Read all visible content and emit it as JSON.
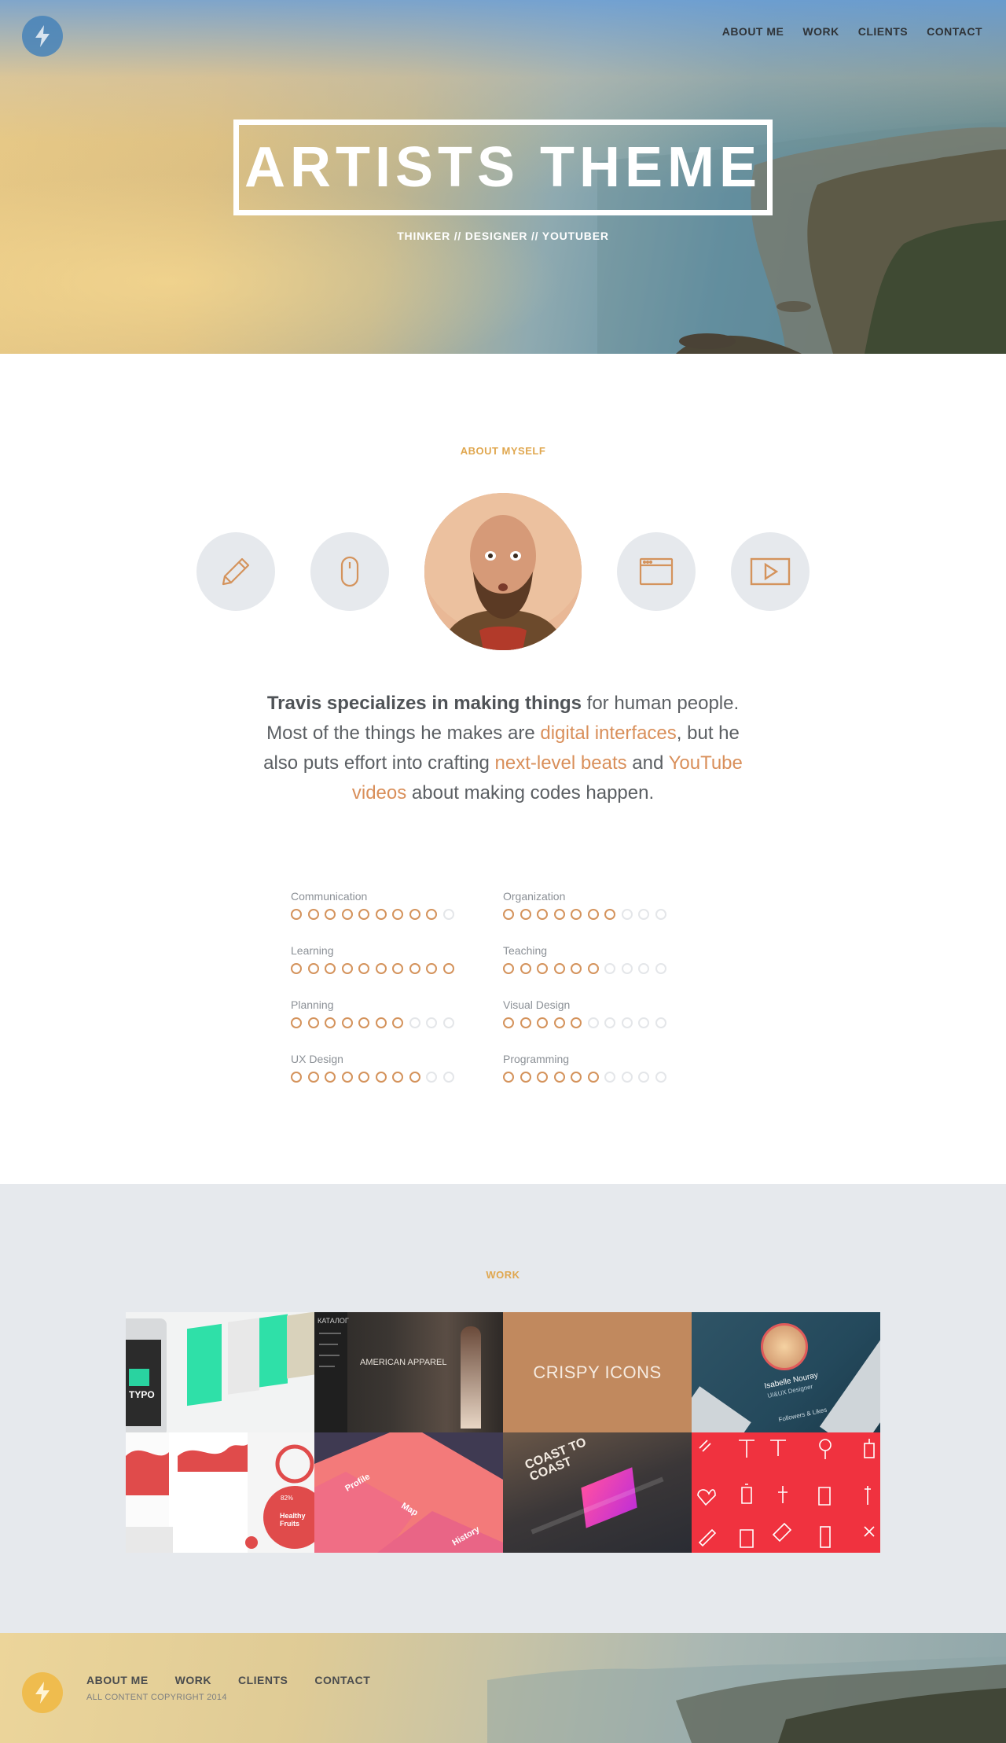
{
  "nav": {
    "items": [
      "ABOUT ME",
      "WORK",
      "CLIENTS",
      "CONTACT"
    ]
  },
  "hero": {
    "title": "ARTISTS THEME",
    "tagline": "THINKER // DESIGNER // YOUTUBER"
  },
  "about": {
    "label": "ABOUT MYSELF",
    "bio": {
      "bold": "Travis specializes in making things",
      "t1": " for human people. Most of the things he makes are ",
      "link1": "digital interfaces",
      "t2": ", but he also puts effort into crafting ",
      "link2": "next-level beats",
      "t3": " and ",
      "link3": "YouTube videos",
      "t4": " about making codes happen."
    },
    "icons": [
      "pencil-icon",
      "mouse-icon",
      "browser-window-icon",
      "play-icon"
    ]
  },
  "skills": [
    {
      "name": "Communication",
      "level": 9
    },
    {
      "name": "Organization",
      "level": 7
    },
    {
      "name": "Learning",
      "level": 10
    },
    {
      "name": "Teaching",
      "level": 6
    },
    {
      "name": "Planning",
      "level": 7
    },
    {
      "name": "Visual Design",
      "level": 5
    },
    {
      "name": "UX Design",
      "level": 8
    },
    {
      "name": "Programming",
      "level": 6
    }
  ],
  "skill_max": 10,
  "work": {
    "label": "WORK",
    "tiles": {
      "typo_brand": "TYPO",
      "catalog_menu": "КАТАЛОГ",
      "apparel_title": "AMERICAN APPAREL",
      "crispy": "CRISPY ICONS",
      "profile_name": "Isabelle Nouray",
      "profile_role": "UI&UX Designer",
      "profile_footer": "Followers & Likes",
      "fruits_pct": "82%",
      "fruits_title": "Healthy Fruits",
      "menu_profile": "Profile",
      "menu_map": "Map",
      "menu_history": "History",
      "coast_title": "COAST TO COAST"
    }
  },
  "footer": {
    "copyright": "ALL CONTENT COPYRIGHT 2014"
  },
  "colors": {
    "accent": "#d98f5a",
    "label": "#e0a74f",
    "bg_gray": "#e6e9ed"
  }
}
